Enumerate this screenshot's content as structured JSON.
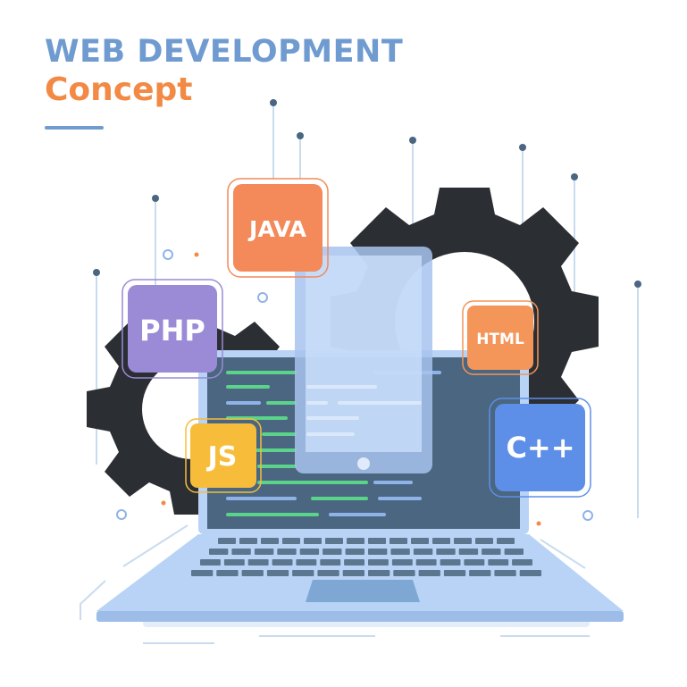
{
  "title": {
    "line1": "WEB DEVELOPMENT",
    "line2": "Concept"
  },
  "badges": {
    "java": "JAVA",
    "php": "PHP",
    "html": "HTML",
    "js": "JS",
    "cpp": "C++"
  },
  "colors": {
    "title_blue": "#6f9bd0",
    "title_orange": "#f28a45",
    "gear": "#2b2f33",
    "laptop_body": "#b8d3f5",
    "screen": "#4a6680",
    "code_green": "#5bd38a",
    "code_blue": "#8fb3e8",
    "java_badge": "#f4895a",
    "php_badge": "#9b8ad6",
    "html_badge": "#f4955a",
    "js_badge": "#f7bd3a",
    "cpp_badge": "#5e8fe8"
  },
  "icons": [
    "gear-icon",
    "laptop-icon",
    "tablet-icon",
    "keyboard-icon"
  ]
}
